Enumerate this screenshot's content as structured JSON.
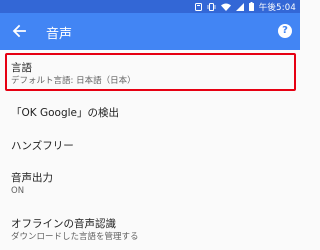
{
  "status_bar": {
    "time": "午後5:04",
    "icons": [
      "notification-icon",
      "vibrate-icon",
      "wifi-icon",
      "signal-icon",
      "battery-icon"
    ]
  },
  "app_bar": {
    "title": "音声",
    "back_icon": "arrow-back-icon",
    "help_icon": "help-icon",
    "help_glyph": "?"
  },
  "settings": {
    "items": [
      {
        "title": "言語",
        "subtitle": "デフォルト言語: 日本語（日本）"
      },
      {
        "title": "「OK Google」の検出",
        "subtitle": ""
      },
      {
        "title": "ハンズフリー",
        "subtitle": ""
      },
      {
        "title": "音声出力",
        "subtitle": "ON"
      },
      {
        "title": "オフラインの音声認識",
        "subtitle": "ダウンロードした言語を管理する"
      }
    ]
  },
  "colors": {
    "status_bar": "#3367d6",
    "app_bar": "#4285f4",
    "highlight": "#e60012",
    "background": "#fafafa"
  }
}
